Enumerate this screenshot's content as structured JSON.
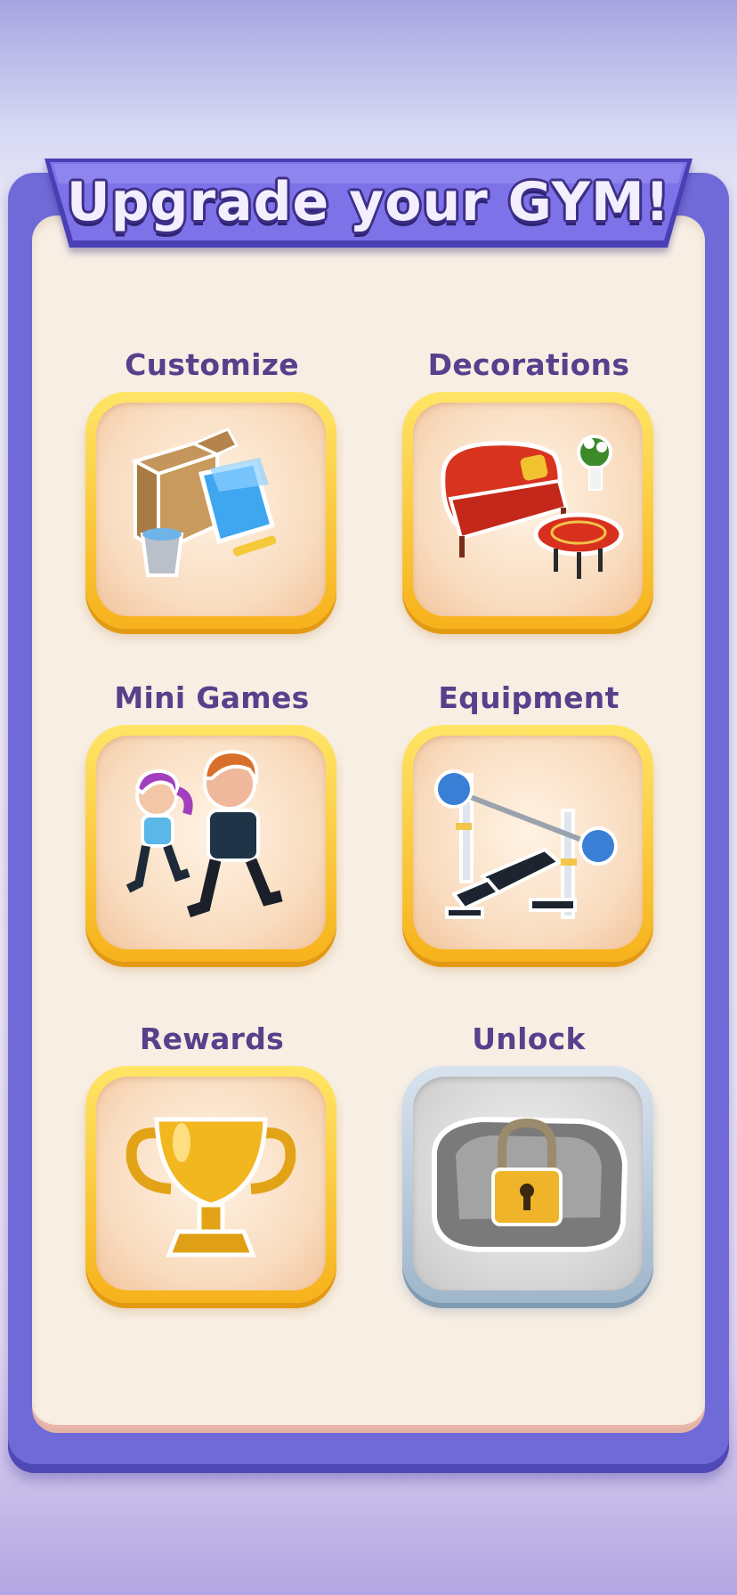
{
  "banner": {
    "title": "Upgrade your GYM!"
  },
  "tiles": [
    {
      "label": "Customize",
      "icon": "box-paint-icon",
      "locked": false
    },
    {
      "label": "Decorations",
      "icon": "sofa-icon",
      "locked": false
    },
    {
      "label": "Mini Games",
      "icon": "runners-icon",
      "locked": false
    },
    {
      "label": "Equipment",
      "icon": "bench-press-icon",
      "locked": false
    },
    {
      "label": "Rewards",
      "icon": "trophy-icon",
      "locked": false
    },
    {
      "label": "Unlock",
      "icon": "locked-bag-icon",
      "locked": true
    }
  ],
  "colors": {
    "frame": "#6f6ad8",
    "panel": "#f8efe4",
    "label": "#5a3f8c",
    "tile_gold": "#f7b21b",
    "tile_locked": "#9fb6ca"
  }
}
